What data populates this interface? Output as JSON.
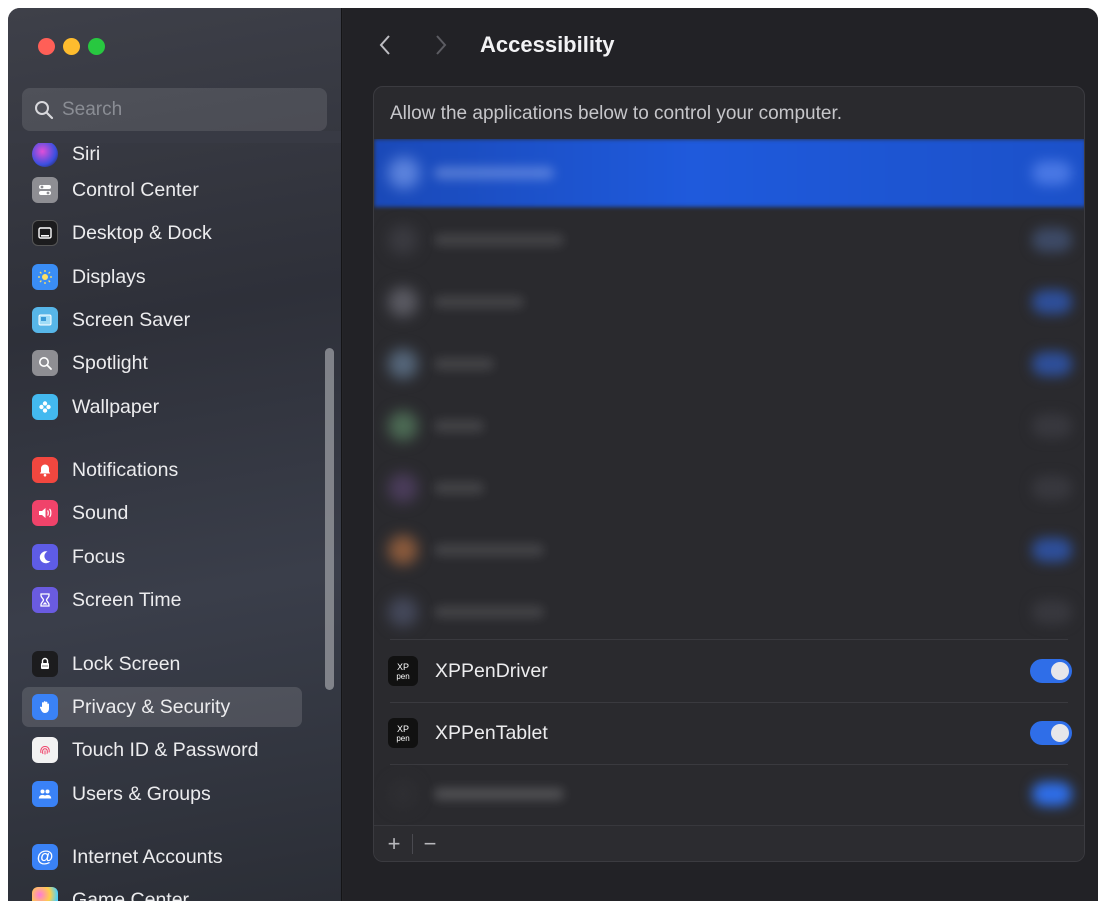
{
  "window": {
    "traffic_lights": [
      "close",
      "minimize",
      "zoom"
    ]
  },
  "sidebar": {
    "search_placeholder": "Search",
    "items": [
      {
        "label": "Siri",
        "icon": "siri-icon",
        "color": "#5a4fd0"
      },
      {
        "label": "Control Center",
        "icon": "control-center-icon",
        "color": "#8e8e93"
      },
      {
        "label": "Desktop & Dock",
        "icon": "desktop-dock-icon",
        "color": "#1c1c1e"
      },
      {
        "label": "Displays",
        "icon": "displays-icon",
        "color": "#3a8df5"
      },
      {
        "label": "Screen Saver",
        "icon": "screen-saver-icon",
        "color": "#57b6e8"
      },
      {
        "label": "Spotlight",
        "icon": "spotlight-icon",
        "color": "#8e8e93"
      },
      {
        "label": "Wallpaper",
        "icon": "wallpaper-icon",
        "color": "#43b9ef"
      },
      {
        "label": "Notifications",
        "icon": "notifications-icon",
        "color": "#f2473f"
      },
      {
        "label": "Sound",
        "icon": "sound-icon",
        "color": "#f0436a"
      },
      {
        "label": "Focus",
        "icon": "focus-icon",
        "color": "#5e5ce6"
      },
      {
        "label": "Screen Time",
        "icon": "screen-time-icon",
        "color": "#6a5be0"
      },
      {
        "label": "Lock Screen",
        "icon": "lock-screen-icon",
        "color": "#1c1c1e"
      },
      {
        "label": "Privacy & Security",
        "icon": "privacy-hand-icon",
        "color": "#3a82f6",
        "selected": true
      },
      {
        "label": "Touch ID & Password",
        "icon": "fingerprint-icon",
        "color": "#f2f2f2"
      },
      {
        "label": "Users & Groups",
        "icon": "users-groups-icon",
        "color": "#3a82f6"
      },
      {
        "label": "Internet Accounts",
        "icon": "at-sign-icon",
        "color": "#3a82f6"
      },
      {
        "label": "Game Center",
        "icon": "game-center-icon",
        "color": "#e8e8ea"
      }
    ]
  },
  "main": {
    "title": "Accessibility",
    "description": "Allow the applications below to control your computer.",
    "apps": [
      {
        "name": "XPPenDriver",
        "enabled": true,
        "icon": "xppen-icon"
      },
      {
        "name": "XPPenTablet",
        "enabled": true,
        "icon": "xppen-icon"
      }
    ],
    "footer": {
      "add": "+",
      "remove": "−"
    }
  },
  "colors": {
    "accent": "#2f6ee8",
    "selection": "#1f5adc",
    "sidebar_bg": "#30333c",
    "main_bg": "#222226"
  }
}
